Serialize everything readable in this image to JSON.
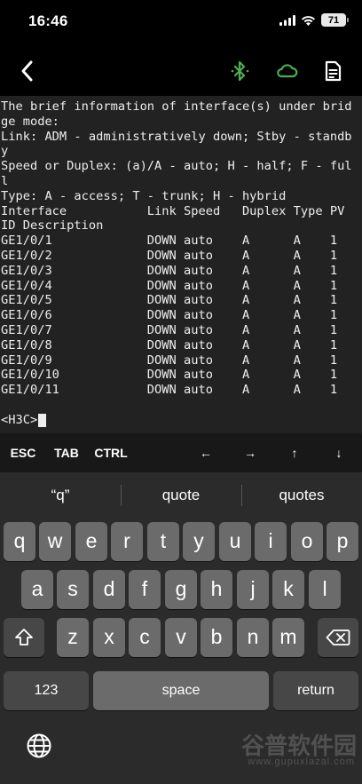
{
  "status_bar": {
    "time": "16:46",
    "battery": "71"
  },
  "nav": {
    "back_icon": "chevron-left-icon",
    "bluetooth_icon": "bluetooth-icon",
    "cloud_icon": "cloud-icon",
    "document_icon": "document-icon",
    "accent_color": "#4caf50"
  },
  "terminal": {
    "lines": [
      "The brief information of interface(s) under brid",
      "ge mode:",
      "Link: ADM - administratively down; Stby - standb",
      "y",
      "Speed or Duplex: (a)/A - auto; H - half; F - ful",
      "l",
      "Type: A - access; T - trunk; H - hybrid",
      "Interface           Link Speed   Duplex Type PV",
      "ID Description",
      "GE1/0/1             DOWN auto    A      A    1",
      "GE1/0/2             DOWN auto    A      A    1",
      "GE1/0/3             DOWN auto    A      A    1",
      "GE1/0/4             DOWN auto    A      A    1",
      "GE1/0/5             DOWN auto    A      A    1",
      "GE1/0/6             DOWN auto    A      A    1",
      "GE1/0/7             DOWN auto    A      A    1",
      "GE1/0/8             DOWN auto    A      A    1",
      "GE1/0/9             DOWN auto    A      A    1",
      "GE1/0/10            DOWN auto    A      A    1",
      "GE1/0/11            DOWN auto    A      A    1"
    ],
    "prompt": "<H3C>"
  },
  "toolbar": {
    "esc": "ESC",
    "tab": "TAB",
    "ctrl": "CTRL",
    "left": "←",
    "right": "→",
    "up": "↑",
    "down": "↓"
  },
  "keyboard": {
    "suggestions": [
      "“q”",
      "quote",
      "quotes"
    ],
    "row1": [
      "q",
      "w",
      "e",
      "r",
      "t",
      "y",
      "u",
      "i",
      "o",
      "p"
    ],
    "row2": [
      "a",
      "s",
      "d",
      "f",
      "g",
      "h",
      "j",
      "k",
      "l"
    ],
    "row3": [
      "z",
      "x",
      "c",
      "v",
      "b",
      "n",
      "m"
    ],
    "shift_icon": "shift-icon",
    "delete_icon": "delete-icon",
    "numbers": "123",
    "space": "space",
    "return": "return",
    "globe_icon": "globe-icon"
  },
  "watermark": {
    "text": "谷普软件园",
    "url": "www.gupuxlazal.com"
  }
}
